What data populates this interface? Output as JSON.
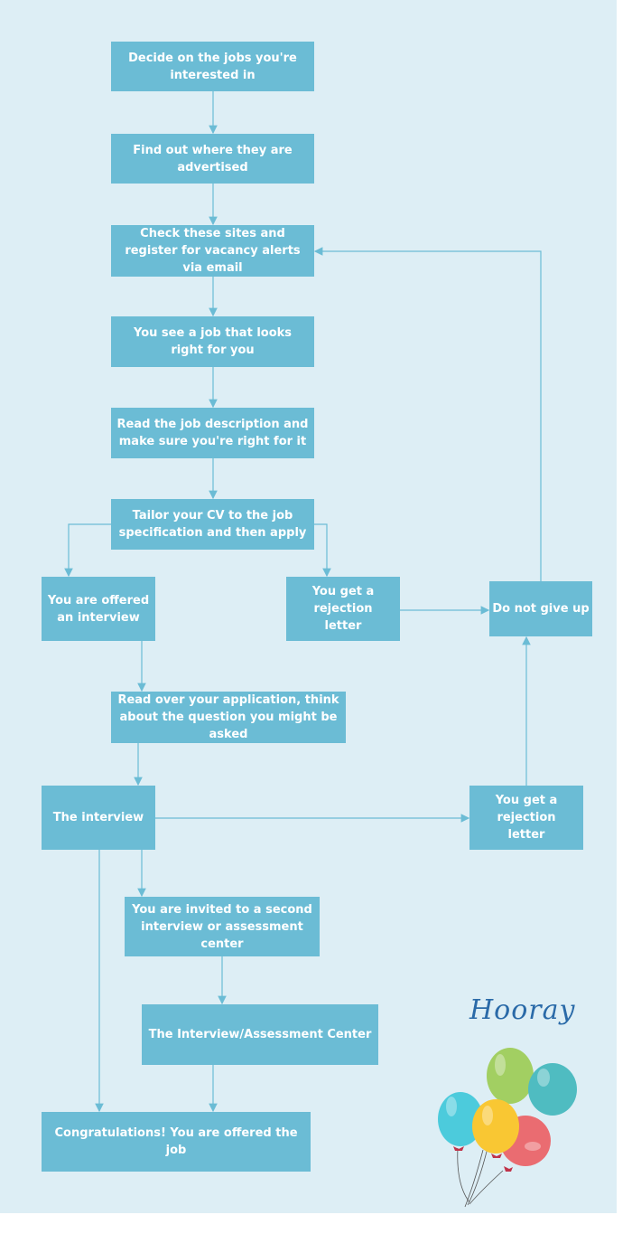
{
  "colors": {
    "background": "#ddeef5",
    "box": "#6bbcd5",
    "connector": "#6bbcd5",
    "hooray": "#2a6aa8"
  },
  "nodes": {
    "decide": "Decide on the jobs you're interested in",
    "find": "Find out where they are advertised",
    "check": "Check these sites and register for vacancy alerts via email",
    "see": "You see a job that looks right for you",
    "read": "Read the job description and make sure you're right for it",
    "tailor": "Tailor your CV to the job specification and then apply",
    "offered": "You are offered an interview",
    "rejection1": "You get a rejection letter",
    "giveup": "Do not give up",
    "readover": "Read over your application, think about the question you might be asked",
    "interview": "The interview",
    "rejection2": "You get a rejection letter",
    "invited": "You are invited to a second interview  or assessment center",
    "assessment": "The Interview/Assessment Center",
    "congrats": "Congratulations! You are offered the job"
  },
  "decoration": {
    "hooray": "Hooray",
    "image": "balloons-icon"
  }
}
